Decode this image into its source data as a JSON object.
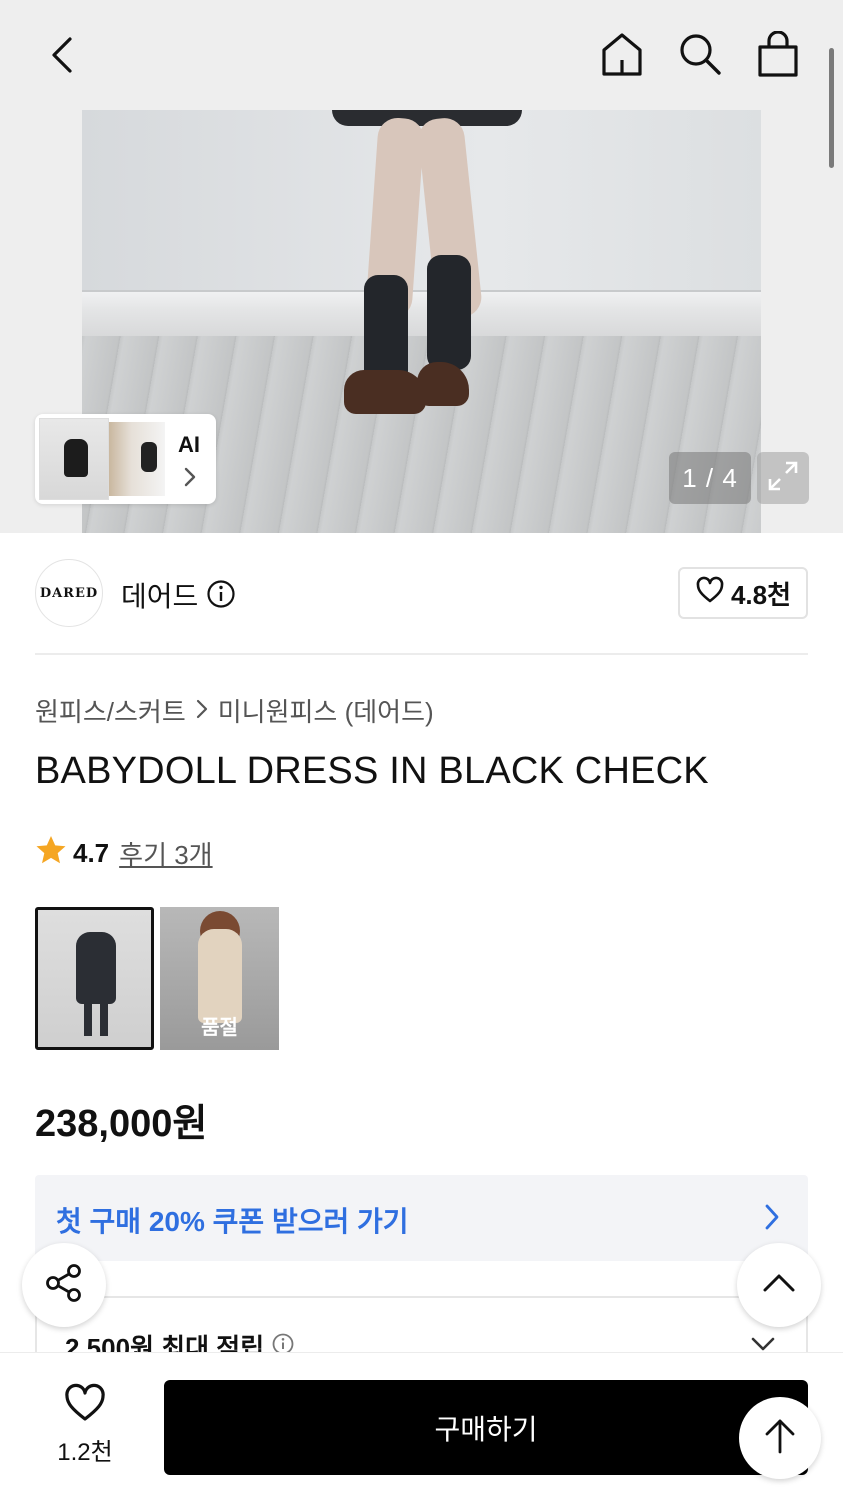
{
  "gallery": {
    "counter": "1 / 4",
    "ai_label": "AI"
  },
  "brand": {
    "logo_text": "DARED",
    "name": "데어드",
    "likes": "4.8천"
  },
  "breadcrumb": {
    "category": "원피스/스커트",
    "subcategory": "미니원피스 (데어드)"
  },
  "product": {
    "title": "BABYDOLL DRESS IN BLACK CHECK",
    "rating": "4.7",
    "reviews": "후기 3개",
    "price": "238,000원",
    "swatch_sold_out": "품절"
  },
  "coupon": {
    "text": "첫 구매 20% 쿠폰 받으러 가기"
  },
  "points": {
    "text": "2,500원 최대 적립"
  },
  "bottom": {
    "wish_count": "1.2천",
    "buy_label": "구매하기"
  },
  "colors": {
    "accent_blue": "#2f6fe0",
    "star": "#f5a623",
    "buy_button": "#000000"
  }
}
